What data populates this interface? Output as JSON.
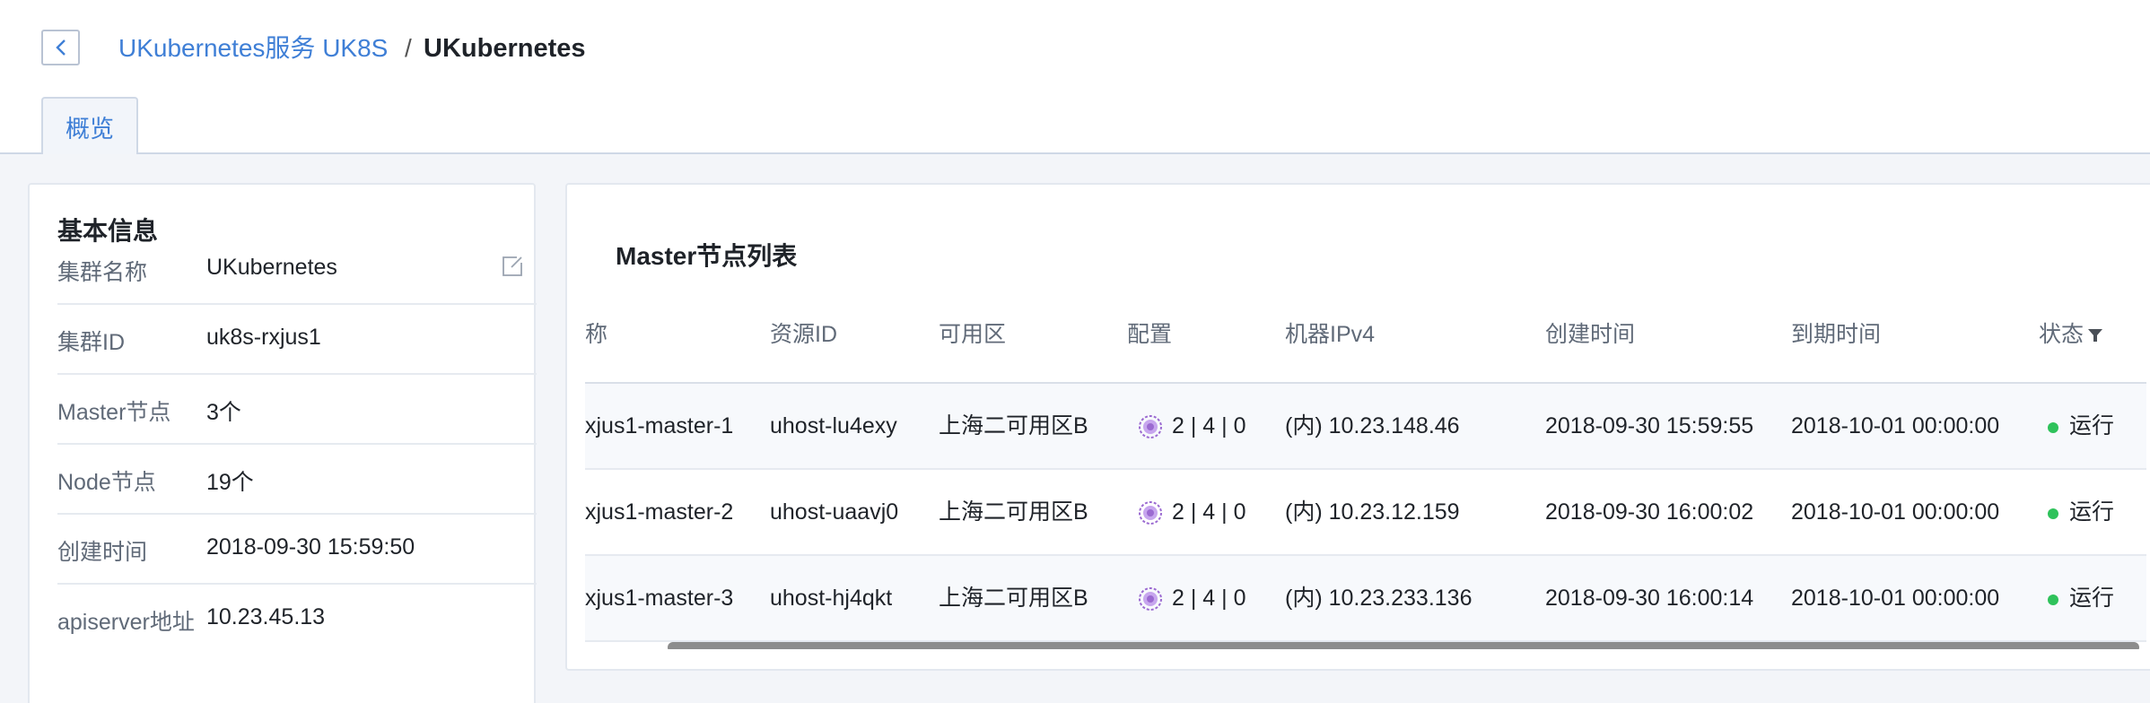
{
  "breadcrumb": {
    "parent": "UKubernetes服务 UK8S",
    "separator": "/",
    "current": "UKubernetes"
  },
  "tabs": [
    {
      "label": "概览",
      "active": true
    }
  ],
  "basic_info": {
    "title": "基本信息",
    "rows": [
      {
        "label": "集群名称",
        "value": "UKubernetes",
        "editable": true
      },
      {
        "label": "集群ID",
        "value": "uk8s-rxjus1"
      },
      {
        "label": "Master节点",
        "value": "3个"
      },
      {
        "label": "Node节点",
        "value": "19个"
      },
      {
        "label": "创建时间",
        "value": "2018-09-30 15:59:50"
      },
      {
        "label": "apiserver地址",
        "value": "10.23.45.13"
      }
    ]
  },
  "master_list": {
    "title": "Master节点列表",
    "columns": [
      "称",
      "资源ID",
      "可用区",
      "配置",
      "机器IPv4",
      "创建时间",
      "到期时间",
      "状态"
    ],
    "rows": [
      {
        "name": "xjus1-master-1",
        "resource_id": "uhost-lu4exy",
        "zone": "上海二可用区B",
        "config": "2 | 4 | 0",
        "ip": "(内) 10.23.148.46",
        "created": "2018-09-30 15:59:55",
        "expires": "2018-10-01 00:00:00",
        "status": "运行"
      },
      {
        "name": "xjus1-master-2",
        "resource_id": "uhost-uaavj0",
        "zone": "上海二可用区B",
        "config": "2 | 4 | 0",
        "ip": "(内) 10.23.12.159",
        "created": "2018-09-30 16:00:02",
        "expires": "2018-10-01 00:00:00",
        "status": "运行"
      },
      {
        "name": "xjus1-master-3",
        "resource_id": "uhost-hj4qkt",
        "zone": "上海二可用区B",
        "config": "2 | 4 | 0",
        "ip": "(内) 10.23.233.136",
        "created": "2018-09-30 16:00:14",
        "expires": "2018-10-01 00:00:00",
        "status": "运行"
      }
    ]
  },
  "colors": {
    "accent": "#3f7fd6",
    "status_running": "#2fc25b",
    "config_icon": "#9b6ad1"
  }
}
